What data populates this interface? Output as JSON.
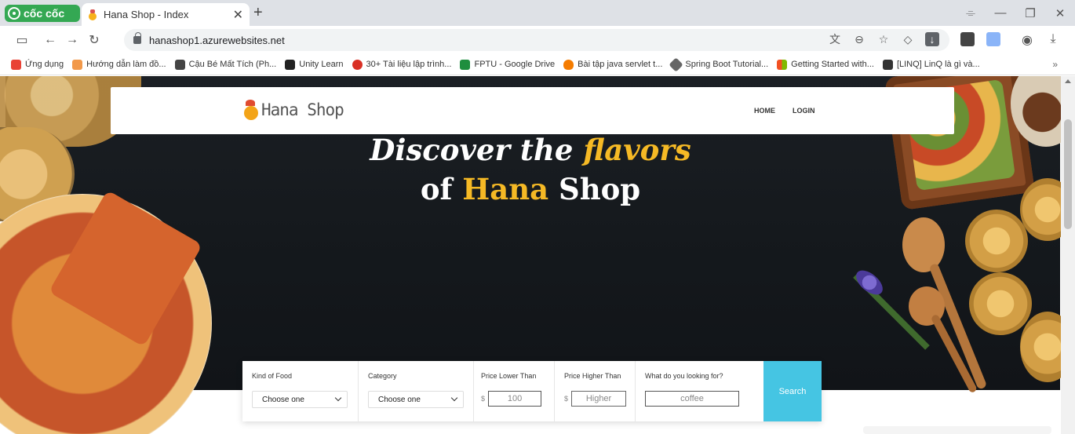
{
  "browser": {
    "brand_label": "cốc cốc",
    "tab_title": "Hana Shop - Index",
    "tab_close": "✕",
    "new_tab": "+",
    "url": "hanashop1.azurewebsites.net"
  },
  "bookmarks": [
    {
      "label": "Ứng dụng",
      "color": "#e94235"
    },
    {
      "label": "Hướng dẫn làm đồ...",
      "color": "#f2994a"
    },
    {
      "label": "Cậu Bé Mất Tích (Ph...",
      "color": "#444444"
    },
    {
      "label": "Unity Learn",
      "color": "#222222"
    },
    {
      "label": "30+ Tài liệu lập trình...",
      "color": "#d93025"
    },
    {
      "label": "FPTU - Google Drive",
      "color": "#1e8e3e"
    },
    {
      "label": "Bài tập java servlet t...",
      "color": "#f57c00"
    },
    {
      "label": "Spring Boot Tutorial...",
      "color": "#666666"
    },
    {
      "label": "Getting Started with...",
      "color": "#f25022"
    },
    {
      "label": "[LINQ] LinQ là gì và...",
      "color": "#333333"
    }
  ],
  "bookmarks_more": "»",
  "site": {
    "logo_text": "Hana Shop",
    "nav": [
      {
        "label": "HOME"
      },
      {
        "label": "LOGIN"
      }
    ],
    "hero": {
      "line1_a": "Discover the ",
      "line1_b": "flavors",
      "line2_a": "of ",
      "line2_b": "Hana",
      "line2_c": " Shop"
    },
    "colors": {
      "accent": "#f5b925",
      "search_button": "#45c5e3"
    },
    "search": {
      "kind_label": "Kind of Food",
      "kind_value": "Choose one",
      "category_label": "Category",
      "category_value": "Choose one",
      "price_lower_label": "Price Lower Than",
      "price_lower_value": "100",
      "price_higher_label": "Price Higher Than",
      "price_higher_placeholder": "Higher",
      "currency": "$",
      "keyword_label": "What do you looking for?",
      "keyword_value": "coffee",
      "button_label": "Search"
    }
  }
}
